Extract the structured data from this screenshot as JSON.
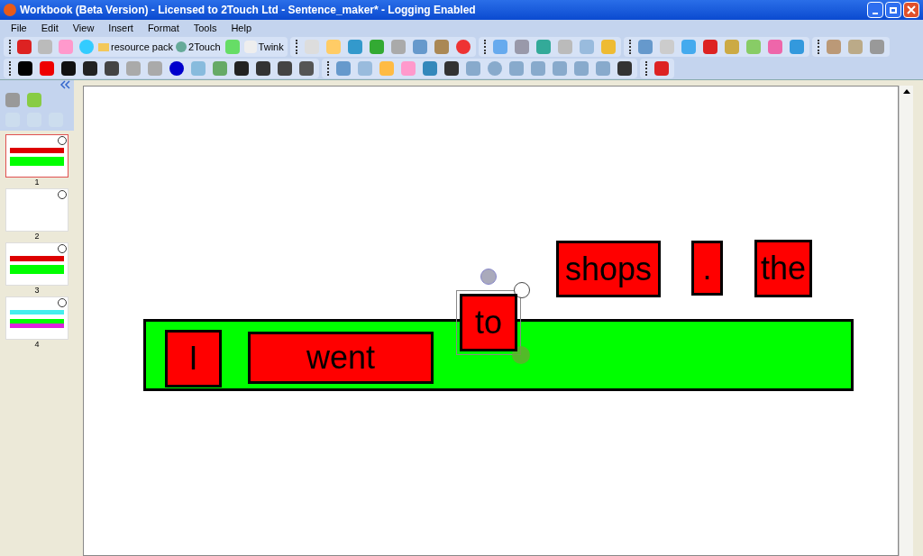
{
  "window": {
    "title": "Workbook (Beta Version) - Licensed to 2Touch Ltd - Sentence_maker* - Logging Enabled"
  },
  "menu": [
    "File",
    "Edit",
    "View",
    "Insert",
    "Format",
    "Tools",
    "Help"
  ],
  "toolbar_labels": [
    "resource pack",
    "2Touch",
    "Twink"
  ],
  "pages": [
    {
      "label": "1",
      "selected": true
    },
    {
      "label": "2",
      "selected": false
    },
    {
      "label": "3",
      "selected": false
    },
    {
      "label": "4",
      "selected": false
    }
  ],
  "sentence_strip": {
    "color": "#00ff00"
  },
  "word_cards": [
    {
      "text": "I",
      "selected": false
    },
    {
      "text": "went",
      "selected": false
    },
    {
      "text": "to",
      "selected": true
    },
    {
      "text": "shops",
      "selected": false
    },
    {
      "text": ".",
      "selected": false
    },
    {
      "text": "the",
      "selected": false
    }
  ]
}
